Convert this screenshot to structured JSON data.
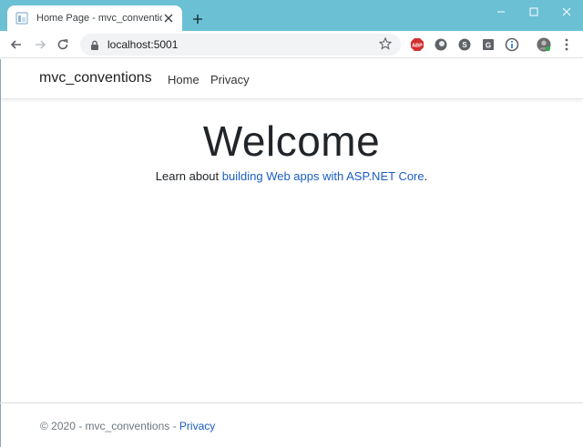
{
  "browser": {
    "tab_title": "Home Page - mvc_conventions",
    "url": "localhost:5001",
    "accent_color": "#6cc0d4"
  },
  "app": {
    "brand": "mvc_conventions",
    "nav": [
      "Home",
      "Privacy"
    ],
    "heading": "Welcome",
    "learn_prefix": "Learn about ",
    "learn_link": "building Web apps with ASP.NET Core",
    "learn_suffix": ".",
    "link_color": "#1a5ec4"
  },
  "footer": {
    "copyright": "© 2020 - mvc_conventions - ",
    "privacy_link": "Privacy"
  }
}
